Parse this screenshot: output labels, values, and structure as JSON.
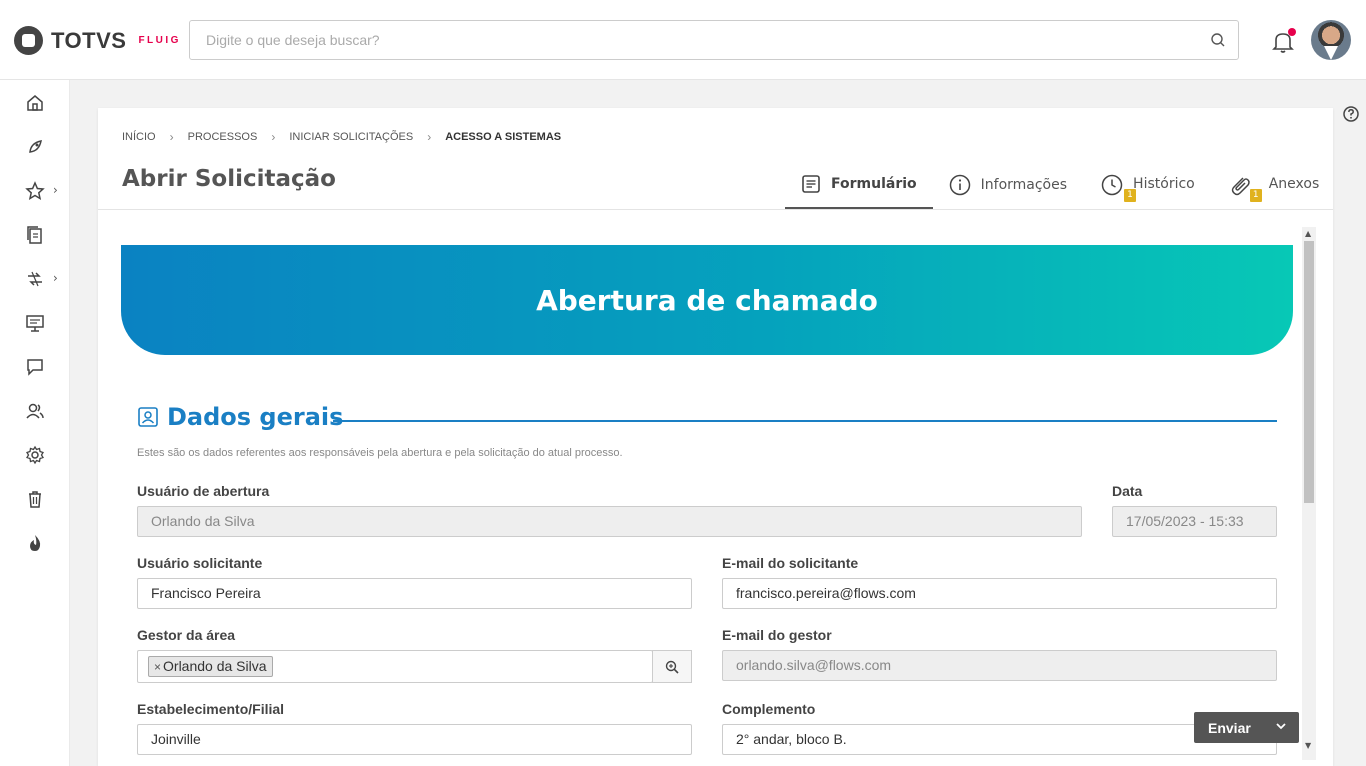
{
  "brand": {
    "name": "TOTVS",
    "product": "FLUIG"
  },
  "search": {
    "placeholder": "Digite o que deseja buscar?"
  },
  "breadcrumb": [
    "INÍCIO",
    "PROCESSOS",
    "INICIAR SOLICITAÇÕES",
    "ACESSO A SISTEMAS"
  ],
  "page": {
    "title": "Abrir Solicitação"
  },
  "tabs": [
    {
      "label": "Formulário",
      "icon": "form-icon"
    },
    {
      "label": "Informações",
      "icon": "info-icon"
    },
    {
      "label": "Histórico",
      "icon": "clock-icon",
      "badge": "1"
    },
    {
      "label": "Anexos",
      "icon": "paperclip-icon",
      "badge": "1"
    }
  ],
  "form": {
    "banner_title": "Abertura de chamado",
    "section_title": "Dados gerais",
    "section_description": "Estes são os dados referentes aos responsáveis pela abertura e pela solicitação do atual processo.",
    "fields": {
      "usuario_abertura": {
        "label": "Usuário de abertura",
        "value": "Orlando da Silva"
      },
      "data": {
        "label": "Data",
        "value": "17/05/2023 - 15:33"
      },
      "usuario_solicitante": {
        "label": "Usuário solicitante",
        "value": "Francisco Pereira"
      },
      "email_solicitante": {
        "label": "E-mail do solicitante",
        "value": "francisco.pereira@flows.com"
      },
      "gestor_area": {
        "label": "Gestor da área",
        "tag": "Orlando da Silva",
        "tag_remove": "×"
      },
      "email_gestor": {
        "label": "E-mail do gestor",
        "value": "orlando.silva@flows.com"
      },
      "estabelecimento": {
        "label": "Estabelecimento/Filial",
        "value": "Joinville"
      },
      "complemento": {
        "label": "Complemento",
        "value": "2° andar, bloco B."
      }
    }
  },
  "actions": {
    "send_label": "Enviar"
  },
  "colors": {
    "accent": "#1a7fc4",
    "banner_start": "#0a82c2",
    "banner_end": "#07c8b6",
    "notification": "#e6004c",
    "badge": "#e0b21e"
  }
}
